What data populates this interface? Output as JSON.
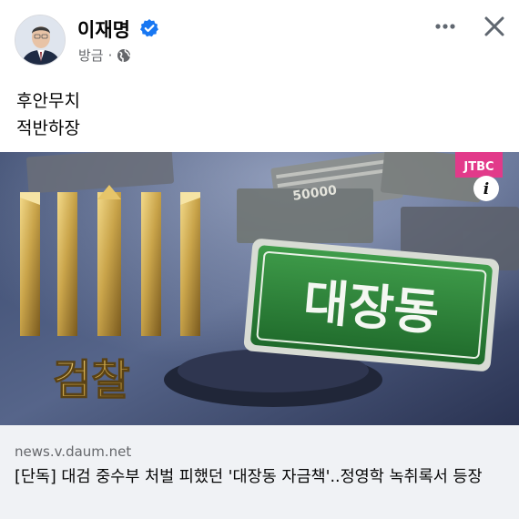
{
  "post": {
    "author": "이재명",
    "time": "방금",
    "separator": "·",
    "body_lines": [
      "후안무치",
      "적반하장"
    ]
  },
  "link_preview": {
    "image_text": {
      "sign": "대장동",
      "emblem_label": "검찰",
      "channel_logo": "JTBC",
      "info_badge": "i",
      "banknote_number": "50000"
    },
    "domain": "news.v.daum.net",
    "title": "[단독] 대검 중수부 처벌 피했던 '대장동 자금책'..정영학 녹취록서 등장"
  },
  "icons": {
    "verified": "verified-badge-icon",
    "audience": "globe-icon",
    "more": "more-options-icon",
    "close": "close-icon"
  },
  "colors": {
    "verified_blue": "#1877f2",
    "sign_green": "#2e7d32",
    "gold": "#c9a44a",
    "meta_gray": "#65676b",
    "footer_bg": "#f0f2f5"
  }
}
